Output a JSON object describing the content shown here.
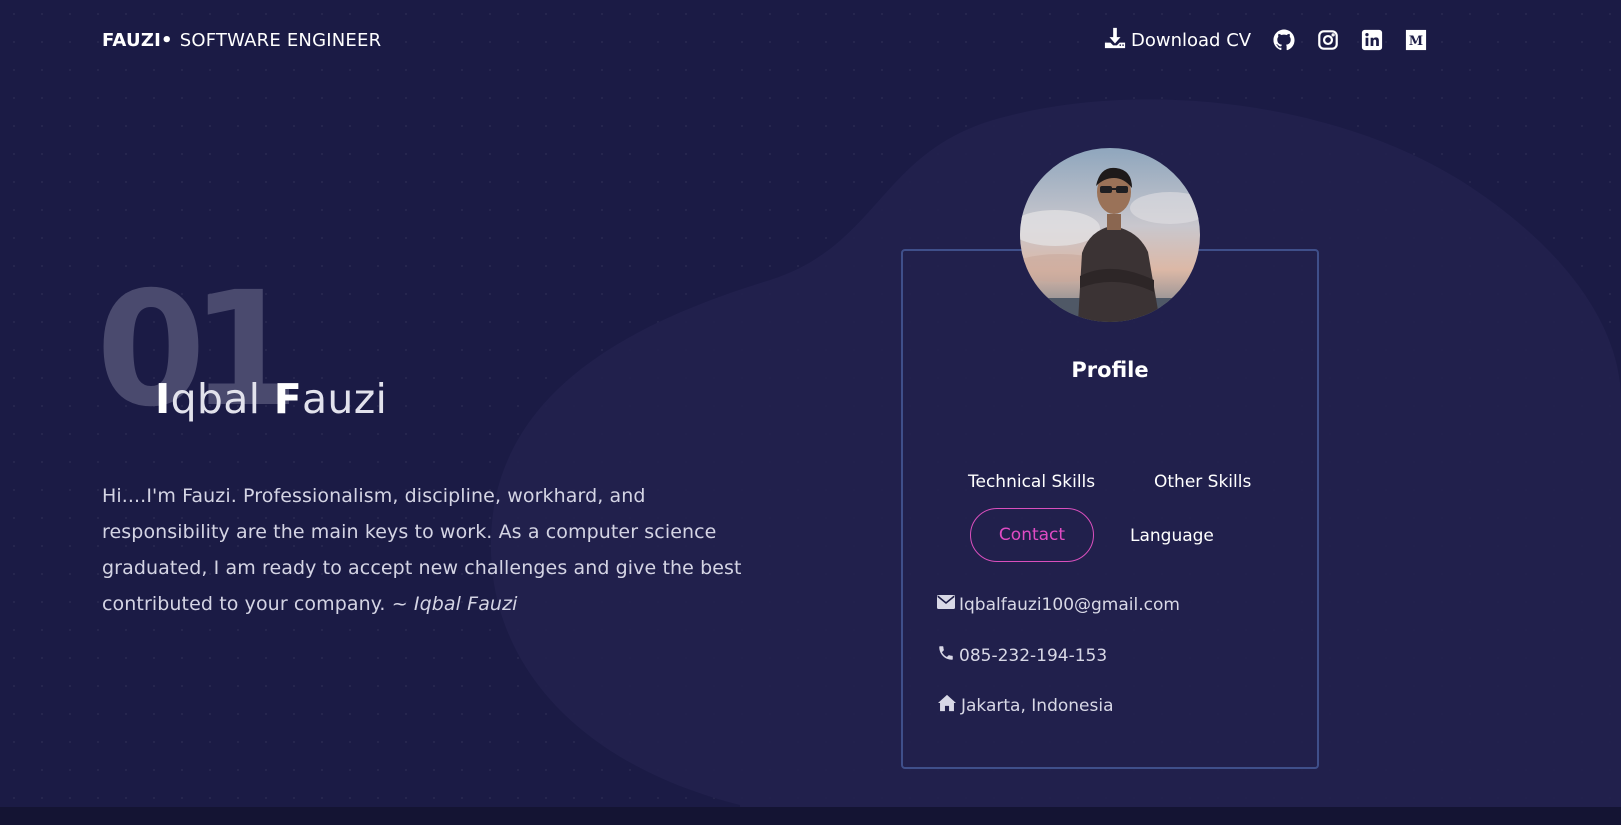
{
  "header": {
    "brand_name": "FAUZI",
    "brand_separator": "•",
    "brand_role": "SOFTWARE ENGINEER",
    "download_label": "Download CV",
    "social_icons": [
      "github-icon",
      "instagram-icon",
      "linkedin-icon",
      "medium-icon"
    ]
  },
  "hero": {
    "number": "01",
    "name_first_initial": "I",
    "name_first_rest": "qbal",
    "name_last_initial": "F",
    "name_last_rest": "auzi",
    "bio": "Hi....I'm Fauzi. Professionalism, discipline, workhard, and responsibility are the main keys to work. As a computer science graduated, I am ready to accept new challenges and give the best contributed to your company.",
    "signature": "~ Iqbal Fauzi"
  },
  "profile": {
    "title": "Profile",
    "tabs": [
      {
        "label": "Technical Skills"
      },
      {
        "label": "Other Skills"
      },
      {
        "label": "Contact"
      },
      {
        "label": "Language"
      }
    ],
    "active_tab": "Contact",
    "contact": {
      "email": "Iqbalfauzi100@gmail.com",
      "phone": "085-232-194-153",
      "address": "Jakarta, Indonesia"
    }
  },
  "colors": {
    "background": "#1b1b45",
    "accent": "#e04bc3",
    "card_border": "#3f4f8a",
    "big_number": "#4a4a6e"
  }
}
